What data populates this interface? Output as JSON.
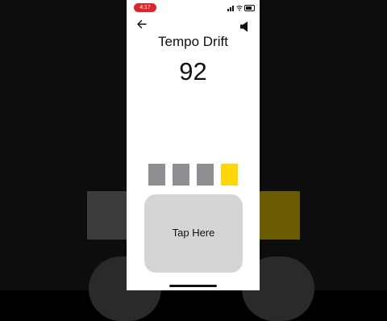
{
  "status_bar": {
    "time": "4:17"
  },
  "header": {
    "back_icon": "arrow-left-icon",
    "sound_icon": "speaker-icon"
  },
  "game": {
    "title": "Tempo Drift",
    "bpm": "92",
    "beats": [
      {
        "state": "inactive",
        "color": "#8e8e93"
      },
      {
        "state": "inactive",
        "color": "#8e8e93"
      },
      {
        "state": "inactive",
        "color": "#8e8e93"
      },
      {
        "state": "active",
        "color": "#ffd60a"
      }
    ],
    "tap_pad": {
      "label": "Tap Here",
      "color": "#d5d5d8"
    }
  },
  "colors": {
    "status_time_bg": "#e0242e",
    "background": "#ffffff",
    "text": "#111111"
  }
}
